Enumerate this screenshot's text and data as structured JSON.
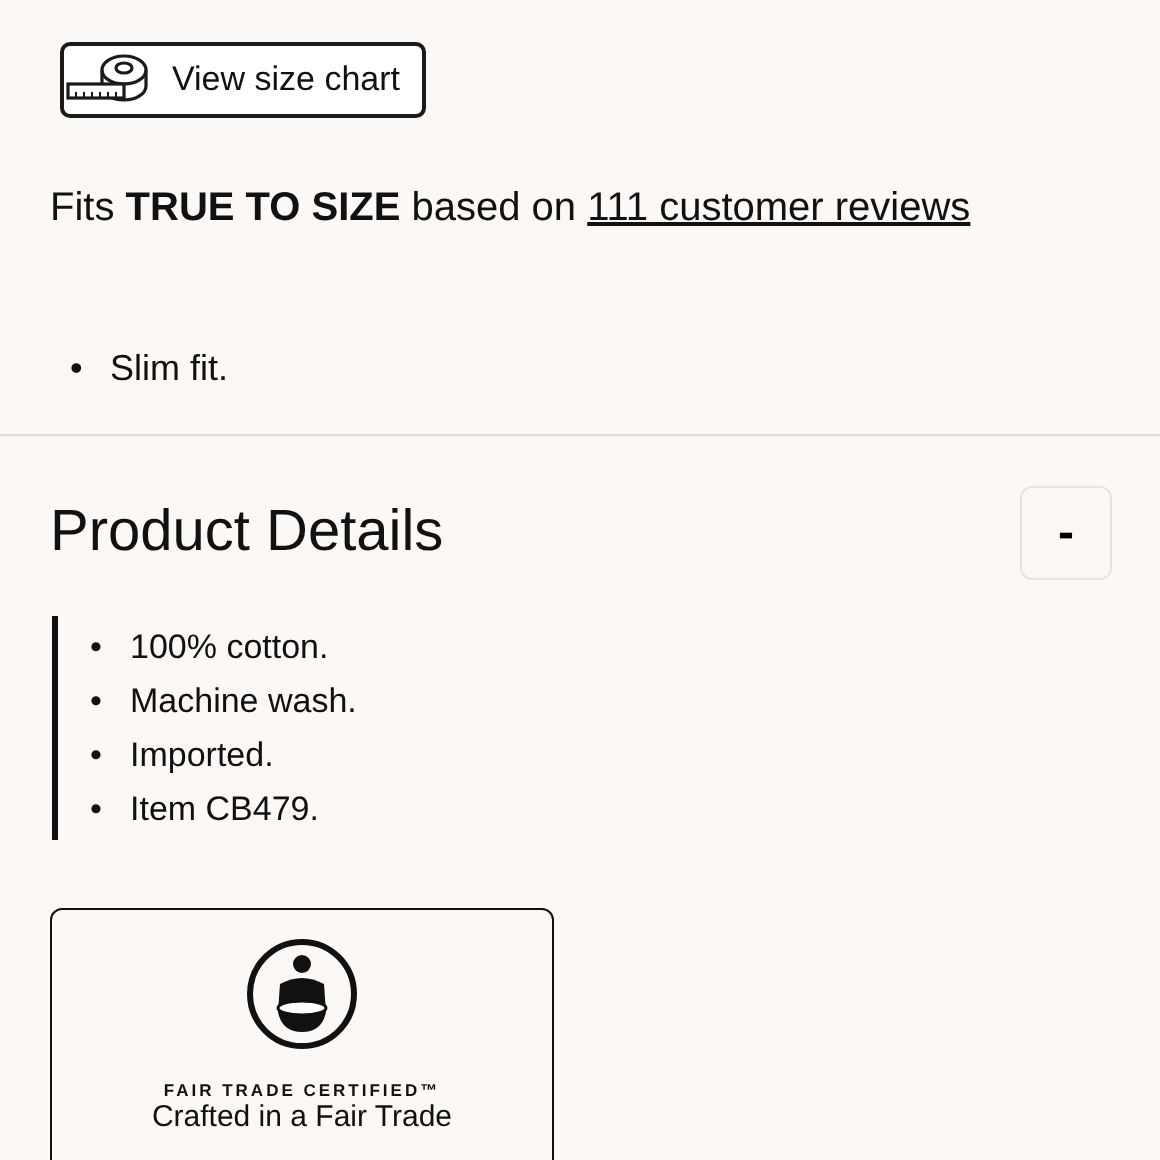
{
  "size_chart_button": {
    "label": "View size chart"
  },
  "fit": {
    "text": "Fits **TRUE TO SIZE** based on",
    "link": "111 customer reviews"
  },
  "fit_notes": [
    {
      "marker": "•",
      "text": "Slim fit."
    }
  ],
  "product_details": {
    "title": "Product Details",
    "toggle": "-",
    "items": [
      {
        "marker": "•",
        "text": "100% cotton."
      },
      {
        "marker": "•",
        "text": "Machine wash."
      },
      {
        "marker": "•",
        "text": "Imported."
      },
      {
        "marker": "•",
        "text": "Item CB479."
      }
    ]
  },
  "certification": {
    "badge": "FAIR TRADE CERTIFIED™",
    "text_lines": [
      "Crafted in a Fair Trade"
    ]
  }
}
